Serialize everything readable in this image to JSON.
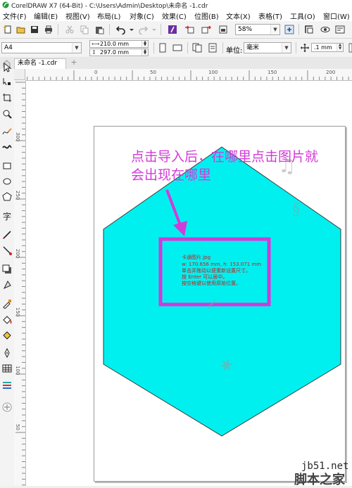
{
  "window": {
    "title": "CorelDRAW X7 (64-Bit) - C:\\Users\\Admin\\Desktop\\未命名 -1.cdr"
  },
  "menubar": {
    "items": [
      "文件(F)",
      "编辑(E)",
      "视图(V)",
      "布局(L)",
      "对象(C)",
      "效果(C)",
      "位图(B)",
      "文本(X)",
      "表格(T)",
      "工具(O)",
      "窗口(W)"
    ]
  },
  "toolbar": {
    "zoom_value": "58%"
  },
  "propbar": {
    "paper_size": "A4",
    "width_value": "210.0 mm",
    "height_value": "297.0 mm",
    "unit_label": "单位:",
    "unit_value": "毫米",
    "nudge_value": ".1 mm"
  },
  "tabs": {
    "document_tab": "未命名 -1.cdr",
    "add_tab": "+"
  },
  "rulers": {
    "h_labels": [
      "0",
      "50",
      "100",
      "150",
      "200"
    ],
    "v_labels": [
      "300",
      "250",
      "200",
      "150",
      "100",
      "50"
    ]
  },
  "annotation": {
    "line1": "点击导入后，在哪里点击图片就",
    "line2": "会出现在哪里"
  },
  "import_hint": {
    "line1": "卡通图片.jpg",
    "line2": "w: 170.656 mm, h: 153.071 mm",
    "line3": "单击并拖动以便重新设置尺寸。",
    "line4": "按 Enter 可以居中。",
    "line5": "按空格键以使用原始位置。"
  },
  "watermark": {
    "site": "jb51.net",
    "brand": "脚本之家"
  },
  "colors": {
    "hexagon_fill": "#00f0ef",
    "annotation_magenta": "#d33ad9",
    "hint_text_red": "#cc1b1b"
  }
}
